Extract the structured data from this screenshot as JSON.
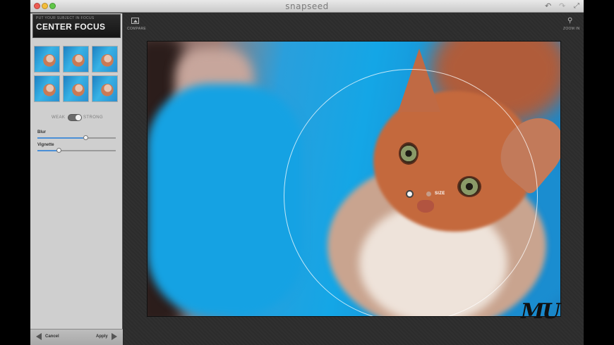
{
  "app": {
    "title": "snapseed",
    "window_controls": [
      "close",
      "minimize",
      "maximize"
    ],
    "toolbar_icons": [
      "undo-icon",
      "redo-icon",
      "fullscreen-icon"
    ]
  },
  "sidebar": {
    "filter_subtitle": "PUT YOUR SUBJECT IN FOCUS",
    "filter_title": "CENTER FOCUS",
    "preset_count": 6,
    "strength": {
      "weak_label": "WEAK",
      "strong_label": "STRONG",
      "selected": "STRONG"
    },
    "sliders": [
      {
        "label": "Blur",
        "value": 0.62
      },
      {
        "label": "Vignette",
        "value": 0.28
      }
    ],
    "cancel_label": "Cancel",
    "apply_label": "Apply"
  },
  "main": {
    "compare_label": "COMPARE",
    "zoom_label": "ZOOM IN",
    "size_label": "SIZE"
  },
  "colors": {
    "accent": "#4a8fd6",
    "sidebar_bg": "#cfcfcf",
    "canvas_bg": "#2c2c2c"
  },
  "watermark": "MU"
}
